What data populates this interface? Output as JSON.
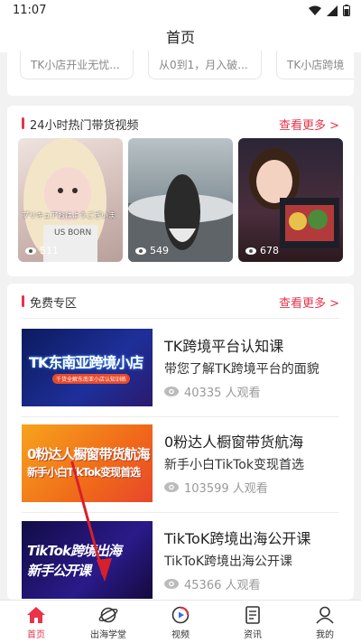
{
  "status": {
    "time": "11:07"
  },
  "header": {
    "title": "首页"
  },
  "top_items": [
    "TK小店开业无忧...",
    "从0到1，月入破...",
    "TK小店跨境"
  ],
  "hot": {
    "title": "24小时热门带货视频",
    "more": "查看更多 >",
    "videos": [
      {
        "views": "511",
        "overlay_text": "プリキュアおはようございま",
        "overlay_text2": "US BORN"
      },
      {
        "views": "549"
      },
      {
        "views": "678"
      }
    ]
  },
  "free": {
    "title": "免费专区",
    "more": "查看更多 >",
    "courses": [
      {
        "thumb_title": "TK东南亚跨境小店",
        "thumb_sub": "千货全解东南亚小店认知训练",
        "title": "TK跨境平台认知课",
        "subtitle": "带您了解TK跨境平台的面貌",
        "views": "40335 人观看"
      },
      {
        "thumb_title": "0粉达人橱窗带货航海",
        "thumb_sub": "新手小白TikTok变现首选",
        "title": "0粉达人橱窗带货航海",
        "subtitle": "新手小白TikTok变现首选",
        "views": "103599 人观看"
      },
      {
        "thumb_title": "TikTok跨境出海",
        "thumb_sub": "新手公开课",
        "title": "TikToK跨境出海公开课",
        "subtitle": "TikToK跨境出海公开课",
        "views": "45366 人观看"
      }
    ]
  },
  "tabs": [
    {
      "label": "首页",
      "icon": "home-icon",
      "active": true
    },
    {
      "label": "出海学堂",
      "icon": "planet-icon"
    },
    {
      "label": "视频",
      "icon": "video-icon"
    },
    {
      "label": "资讯",
      "icon": "news-icon"
    },
    {
      "label": "我的",
      "icon": "user-icon"
    }
  ],
  "colors": {
    "accent": "#e8334a"
  }
}
